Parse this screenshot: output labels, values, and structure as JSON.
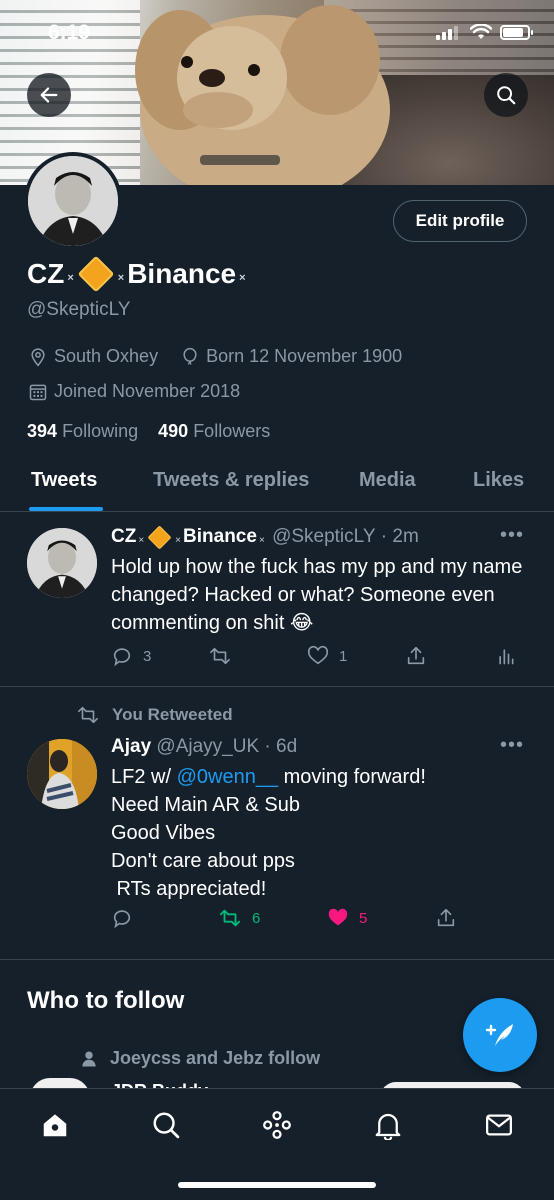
{
  "status_bar": {
    "time": "6:19"
  },
  "profile": {
    "name_part1": "CZ",
    "name_part2": "Binance",
    "separator": "×",
    "handle": "@SkepticLY",
    "edit_label": "Edit profile",
    "location": "South Oxhey",
    "born": "Born 12 November 1900",
    "joined": "Joined November 2018",
    "following_count": "394",
    "following_label": "Following",
    "followers_count": "490",
    "followers_label": "Followers"
  },
  "tabs": [
    {
      "label": "Tweets",
      "active": true
    },
    {
      "label": "Tweets & replies",
      "active": false
    },
    {
      "label": "Media",
      "active": false
    },
    {
      "label": "Likes",
      "active": false
    }
  ],
  "tweets": [
    {
      "name_part1": "CZ",
      "name_part2": "Binance",
      "handle": "@SkepticLY",
      "time": "· 2m",
      "text": "Hold up how the fuck has my pp and my name changed? Hacked or what? Someone even commenting on shit 😂",
      "replies": "3",
      "retweets": "",
      "likes": "1"
    },
    {
      "retweeted_label": "You Retweeted",
      "name": "Ajay",
      "handle": "@Ajayy_UK",
      "time": "· 6d",
      "text_line1_prefix": "LF2 w/ ",
      "mention": "@0wenn__",
      "text_line1_suffix": " moving forward!",
      "text_line2": "Need Main AR & Sub",
      "text_line3": "Good Vibes",
      "text_line4": "Don't care about pps",
      "text_line5": " RTs appreciated!",
      "retweets": "6",
      "likes": "5"
    }
  ],
  "who_to_follow": {
    "title": "Who to follow",
    "subtitle": "Joeycss and Jebz follow",
    "peek_name": "JDR Buddy"
  },
  "colors": {
    "background": "#15202b",
    "accent": "#1d9bf0",
    "retweet_green": "#00ba7c",
    "like_pink": "#f91880",
    "muted": "#8b98a5"
  }
}
